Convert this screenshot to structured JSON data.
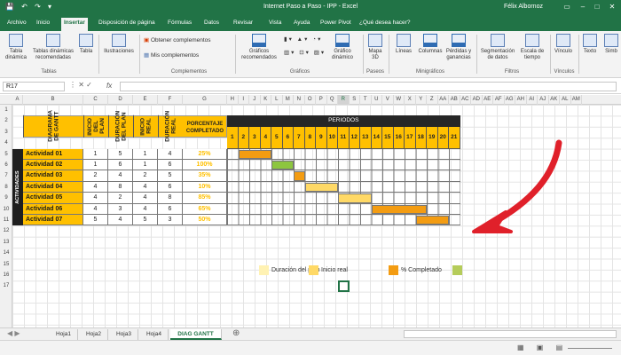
{
  "window": {
    "title": "Internet Paso a Paso - IPP - Excel",
    "user": "Félix Albornoz",
    "accent": "#217346"
  },
  "ribbon_tabs": [
    "Archivo",
    "Inicio",
    "Insertar",
    "Disposición de página",
    "Fórmulas",
    "Datos",
    "Revisar",
    "Vista",
    "Ayuda",
    "Power Pivot",
    "¿Qué desea hacer?"
  ],
  "active_tab": "Insertar",
  "ribbon": {
    "buttons": {
      "tabla_dinamica": "Tabla dinámica",
      "tablas_recomendadas": "Tablas dinámicas recomendadas",
      "tabla": "Tabla",
      "ilustraciones": "Ilustraciones",
      "obtener_complementos": "Obtener complementos",
      "mis_complementos": "Mis complementos",
      "graficos_recomendados": "Gráficos recomendados",
      "grafico_dinamico": "Gráfico dinámico",
      "mapa_3d": "Mapa 3D",
      "lineas": "Líneas",
      "columnas": "Columnas",
      "perdidas_ganancias": "Pérdidas y ganancias",
      "segmentacion": "Segmentación de datos",
      "escala_tiempo": "Escala de tiempo",
      "vinculo": "Vínculo",
      "texto": "Texto",
      "simbolos": "Simb"
    },
    "groups": {
      "tablas": "Tablas",
      "complementos": "Complementos",
      "graficos": "Gráficos",
      "paseos": "Paseos",
      "minigraficos": "Minigráficos",
      "filtros": "Filtros",
      "vinculos": "Vínculos"
    }
  },
  "formula_bar": {
    "name_box": "R17",
    "fx": "fx"
  },
  "columns": [
    "A",
    "B",
    "C",
    "D",
    "E",
    "F",
    "G",
    "H",
    "I",
    "J",
    "K",
    "L",
    "M",
    "N",
    "O",
    "P",
    "Q",
    "R",
    "S",
    "T",
    "U",
    "V",
    "W",
    "X",
    "Y",
    "Z",
    "AA",
    "AB",
    "AC",
    "AD",
    "AE",
    "AF",
    "AG",
    "AH",
    "AI",
    "AJ",
    "AK",
    "AL",
    "AM"
  ],
  "rows": [
    "1",
    "2",
    "3",
    "4",
    "5",
    "6",
    "7",
    "8",
    "9",
    "10",
    "11",
    "12",
    "13",
    "14",
    "15",
    "16",
    "17"
  ],
  "gantt": {
    "hdr_diagrama": "DIAGRAMA DE GANTT",
    "hdr_inicio_plan": "INICIO DEL PLAN",
    "hdr_duracion_plan": "DURACIÓN DEL PLAN",
    "hdr_inicio_real": "INICIO REAL",
    "hdr_duracion_real": "DURACIÓN REAL",
    "hdr_porcentaje": "PORCENTAJE COMPLETADO",
    "hdr_periodos": "PERIODOS",
    "actividades_label": "ACTIVIDADES",
    "periods": [
      "1",
      "2",
      "3",
      "4",
      "5",
      "6",
      "7",
      "8",
      "9",
      "10",
      "11",
      "12",
      "13",
      "14",
      "15",
      "16",
      "17",
      "18",
      "19",
      "20",
      "21"
    ],
    "activities": [
      {
        "name": "Actividad 01",
        "inicio_plan": "1",
        "duracion_plan": "5",
        "inicio_real": "1",
        "duracion_real": "4",
        "pct": "25%",
        "bar_start": 2,
        "bar_len": 3,
        "bar_color": "#f39c12"
      },
      {
        "name": "Actividad 02",
        "inicio_plan": "1",
        "duracion_plan": "6",
        "inicio_real": "1",
        "duracion_real": "6",
        "pct": "100%",
        "bar_start": 5,
        "bar_len": 2,
        "bar_color": "#8dc63f"
      },
      {
        "name": "Actividad 03",
        "inicio_plan": "2",
        "duracion_plan": "4",
        "inicio_real": "2",
        "duracion_real": "5",
        "pct": "35%",
        "bar_start": 7,
        "bar_len": 1,
        "bar_color": "#f39c12"
      },
      {
        "name": "Actividad 04",
        "inicio_plan": "4",
        "duracion_plan": "8",
        "inicio_real": "4",
        "duracion_real": "6",
        "pct": "10%",
        "bar_start": 8,
        "bar_len": 3,
        "bar_color": "#ffd966"
      },
      {
        "name": "Actividad 05",
        "inicio_plan": "4",
        "duracion_plan": "2",
        "inicio_real": "4",
        "duracion_real": "8",
        "pct": "85%",
        "bar_start": 11,
        "bar_len": 3,
        "bar_color": "#ffd966"
      },
      {
        "name": "Actividad 06",
        "inicio_plan": "4",
        "duracion_plan": "3",
        "inicio_real": "4",
        "duracion_real": "6",
        "pct": "65%",
        "bar_start": 14,
        "bar_len": 5,
        "bar_color": "#f39c12"
      },
      {
        "name": "Actividad 07",
        "inicio_plan": "5",
        "duracion_plan": "4",
        "inicio_real": "5",
        "duracion_real": "3",
        "pct": "50%",
        "bar_start": 18,
        "bar_len": 3,
        "bar_color": "#f39c12"
      }
    ]
  },
  "legend": {
    "items": [
      {
        "label": "Duración del plan",
        "color": "#fff2b3"
      },
      {
        "label": "Inicio real",
        "color": "#ffd966"
      },
      {
        "label": "% Completado",
        "color": "#f39c12"
      },
      {
        "label": "",
        "color": "#b5cc5a"
      }
    ]
  },
  "sheet_tabs": [
    "Hoja1",
    "Hoja2",
    "Hoja3",
    "Hoja4",
    "DIAG GANTT"
  ],
  "active_sheet": "DIAG GANTT",
  "colors": {
    "header_yellow": "#ffc000",
    "dark_header": "#262626",
    "arrow_red": "#e0202a"
  }
}
